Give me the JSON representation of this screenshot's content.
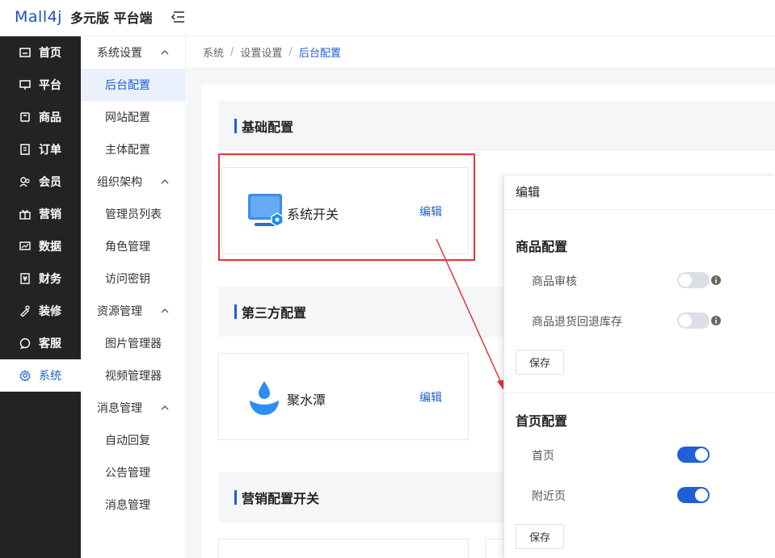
{
  "app": {
    "logo_mark": "Mall4j",
    "logo_title": "多元版 平台端"
  },
  "sidebar": {
    "items": [
      {
        "label": "首页",
        "icon": "home-icon"
      },
      {
        "label": "平台",
        "icon": "monitor-icon"
      },
      {
        "label": "商品",
        "icon": "product-icon"
      },
      {
        "label": "订单",
        "icon": "order-icon"
      },
      {
        "label": "会员",
        "icon": "member-icon"
      },
      {
        "label": "营销",
        "icon": "gift-icon"
      },
      {
        "label": "数据",
        "icon": "chart-icon"
      },
      {
        "label": "财务",
        "icon": "finance-icon"
      },
      {
        "label": "装修",
        "icon": "decorate-icon"
      },
      {
        "label": "客服",
        "icon": "chat-icon"
      },
      {
        "label": "系统",
        "icon": "gear-icon",
        "active": true
      }
    ]
  },
  "submenu": {
    "g1": "系统设置",
    "g1_items": [
      "后台配置",
      "网站配置",
      "主体配置"
    ],
    "g2": "组织架构",
    "g2_items": [
      "管理员列表",
      "角色管理",
      "访问密钥"
    ],
    "g3": "资源管理",
    "g3_items": [
      "图片管理器",
      "视频管理器"
    ],
    "g4": "消息管理",
    "g4_items": [
      "自动回复",
      "公告管理",
      "消息管理"
    ]
  },
  "breadcrumb": {
    "items": [
      "系统",
      "设置设置",
      "后台配置"
    ],
    "sep": "/"
  },
  "sections": {
    "basic": "基础配置",
    "third": "第三方配置",
    "marketing": "营销配置开关"
  },
  "cards": {
    "system_switch": {
      "name": "系统开关",
      "edit": "编辑"
    },
    "jushuitan": {
      "name": "聚水潭",
      "edit": "编辑"
    }
  },
  "drawer": {
    "title": "编辑",
    "product_section": "商品配置",
    "product_audit": "商品审核",
    "product_return_stock": "商品退货回退库存",
    "home_section": "首页配置",
    "home_page": "首页",
    "nearby_page": "附近页",
    "save": "保存",
    "toggles": {
      "product_audit": false,
      "product_return_stock": false,
      "home_page": true,
      "nearby_page": true
    }
  },
  "colors": {
    "accent": "#1f5fd8",
    "sidebar_bg": "#232323",
    "highlight": "#e5323a"
  }
}
